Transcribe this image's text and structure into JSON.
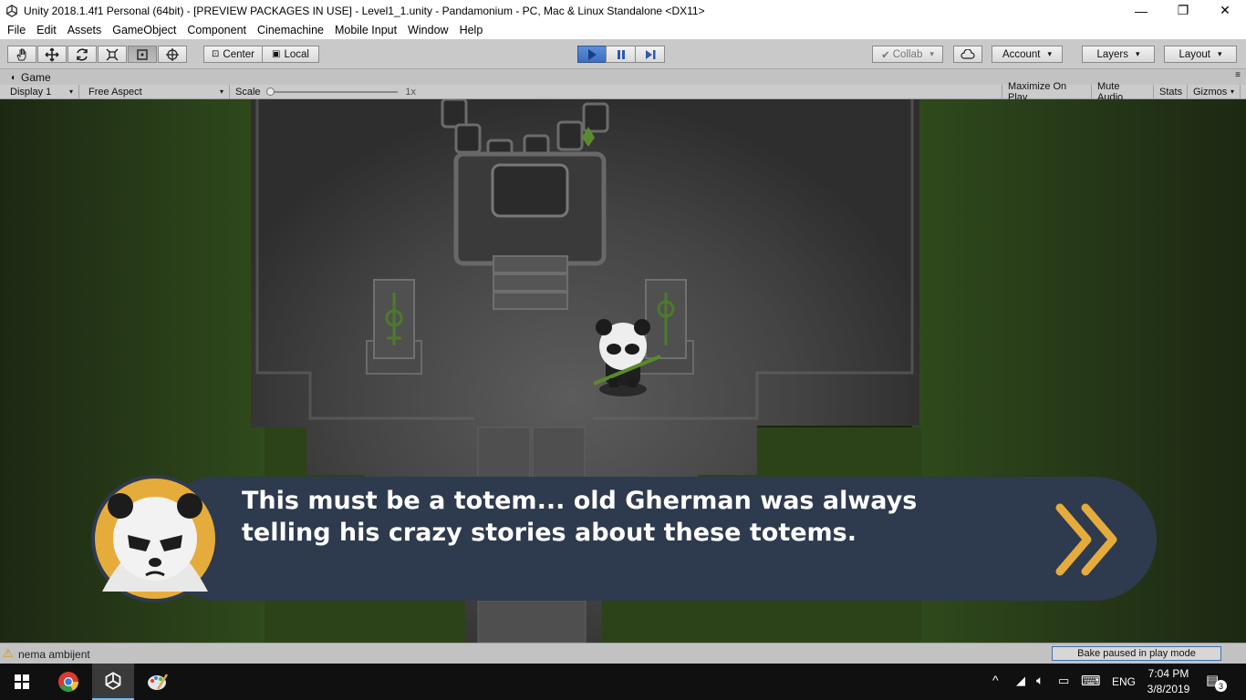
{
  "window": {
    "title": "Unity 2018.1.4f1 Personal (64bit) - [PREVIEW PACKAGES IN USE] - Level1_1.unity - Pandamonium - PC, Mac & Linux Standalone <DX11>",
    "minimize": "—",
    "maximize": "❐",
    "close": "✕"
  },
  "menu": [
    "File",
    "Edit",
    "Assets",
    "GameObject",
    "Component",
    "Cinemachine",
    "Mobile Input",
    "Window",
    "Help"
  ],
  "toolbar": {
    "center_label": "Center",
    "local_label": "Local",
    "collab_label": "Collab",
    "account_label": "Account",
    "layers_label": "Layers",
    "layout_label": "Layout"
  },
  "game_panel": {
    "tab_label": "Game",
    "display": "Display 1",
    "aspect": "Free Aspect",
    "scale_label": "Scale",
    "scale_value": "1x",
    "maximize_on_play": "Maximize On Play",
    "mute_audio": "Mute Audio",
    "stats": "Stats",
    "gizmos": "Gizmos"
  },
  "dialogue": {
    "line1": "This must be a totem... old Gherman was always",
    "line2": "telling his crazy stories about these totems.",
    "next_icon": "double-chevron-right-icon",
    "accent_color": "#e6ac3b",
    "box_color": "#2e3a4e"
  },
  "status": {
    "warning_text": "nema ambijent",
    "bake_text": "Bake paused in play mode"
  },
  "taskbar": {
    "language": "ENG",
    "time": "7:04 PM",
    "date": "3/8/2019",
    "notification_count": "3"
  }
}
